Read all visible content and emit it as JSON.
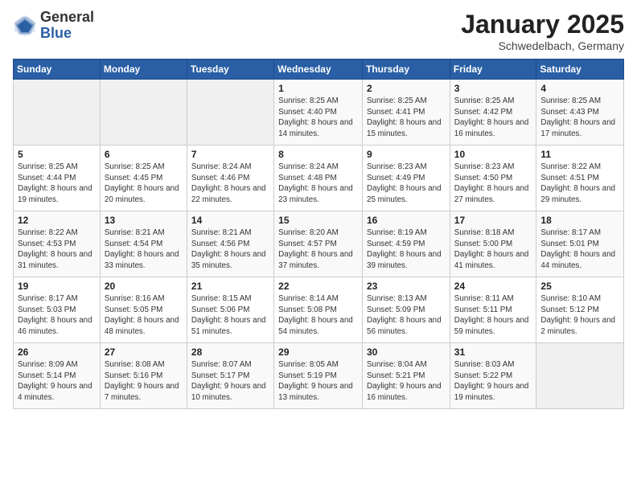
{
  "logo": {
    "general": "General",
    "blue": "Blue"
  },
  "header": {
    "month": "January 2025",
    "location": "Schwedelbach, Germany"
  },
  "weekdays": [
    "Sunday",
    "Monday",
    "Tuesday",
    "Wednesday",
    "Thursday",
    "Friday",
    "Saturday"
  ],
  "weeks": [
    [
      {
        "day": "",
        "sunrise": "",
        "sunset": "",
        "daylight": ""
      },
      {
        "day": "",
        "sunrise": "",
        "sunset": "",
        "daylight": ""
      },
      {
        "day": "",
        "sunrise": "",
        "sunset": "",
        "daylight": ""
      },
      {
        "day": "1",
        "sunrise": "Sunrise: 8:25 AM",
        "sunset": "Sunset: 4:40 PM",
        "daylight": "Daylight: 8 hours and 14 minutes."
      },
      {
        "day": "2",
        "sunrise": "Sunrise: 8:25 AM",
        "sunset": "Sunset: 4:41 PM",
        "daylight": "Daylight: 8 hours and 15 minutes."
      },
      {
        "day": "3",
        "sunrise": "Sunrise: 8:25 AM",
        "sunset": "Sunset: 4:42 PM",
        "daylight": "Daylight: 8 hours and 16 minutes."
      },
      {
        "day": "4",
        "sunrise": "Sunrise: 8:25 AM",
        "sunset": "Sunset: 4:43 PM",
        "daylight": "Daylight: 8 hours and 17 minutes."
      }
    ],
    [
      {
        "day": "5",
        "sunrise": "Sunrise: 8:25 AM",
        "sunset": "Sunset: 4:44 PM",
        "daylight": "Daylight: 8 hours and 19 minutes."
      },
      {
        "day": "6",
        "sunrise": "Sunrise: 8:25 AM",
        "sunset": "Sunset: 4:45 PM",
        "daylight": "Daylight: 8 hours and 20 minutes."
      },
      {
        "day": "7",
        "sunrise": "Sunrise: 8:24 AM",
        "sunset": "Sunset: 4:46 PM",
        "daylight": "Daylight: 8 hours and 22 minutes."
      },
      {
        "day": "8",
        "sunrise": "Sunrise: 8:24 AM",
        "sunset": "Sunset: 4:48 PM",
        "daylight": "Daylight: 8 hours and 23 minutes."
      },
      {
        "day": "9",
        "sunrise": "Sunrise: 8:23 AM",
        "sunset": "Sunset: 4:49 PM",
        "daylight": "Daylight: 8 hours and 25 minutes."
      },
      {
        "day": "10",
        "sunrise": "Sunrise: 8:23 AM",
        "sunset": "Sunset: 4:50 PM",
        "daylight": "Daylight: 8 hours and 27 minutes."
      },
      {
        "day": "11",
        "sunrise": "Sunrise: 8:22 AM",
        "sunset": "Sunset: 4:51 PM",
        "daylight": "Daylight: 8 hours and 29 minutes."
      }
    ],
    [
      {
        "day": "12",
        "sunrise": "Sunrise: 8:22 AM",
        "sunset": "Sunset: 4:53 PM",
        "daylight": "Daylight: 8 hours and 31 minutes."
      },
      {
        "day": "13",
        "sunrise": "Sunrise: 8:21 AM",
        "sunset": "Sunset: 4:54 PM",
        "daylight": "Daylight: 8 hours and 33 minutes."
      },
      {
        "day": "14",
        "sunrise": "Sunrise: 8:21 AM",
        "sunset": "Sunset: 4:56 PM",
        "daylight": "Daylight: 8 hours and 35 minutes."
      },
      {
        "day": "15",
        "sunrise": "Sunrise: 8:20 AM",
        "sunset": "Sunset: 4:57 PM",
        "daylight": "Daylight: 8 hours and 37 minutes."
      },
      {
        "day": "16",
        "sunrise": "Sunrise: 8:19 AM",
        "sunset": "Sunset: 4:59 PM",
        "daylight": "Daylight: 8 hours and 39 minutes."
      },
      {
        "day": "17",
        "sunrise": "Sunrise: 8:18 AM",
        "sunset": "Sunset: 5:00 PM",
        "daylight": "Daylight: 8 hours and 41 minutes."
      },
      {
        "day": "18",
        "sunrise": "Sunrise: 8:17 AM",
        "sunset": "Sunset: 5:01 PM",
        "daylight": "Daylight: 8 hours and 44 minutes."
      }
    ],
    [
      {
        "day": "19",
        "sunrise": "Sunrise: 8:17 AM",
        "sunset": "Sunset: 5:03 PM",
        "daylight": "Daylight: 8 hours and 46 minutes."
      },
      {
        "day": "20",
        "sunrise": "Sunrise: 8:16 AM",
        "sunset": "Sunset: 5:05 PM",
        "daylight": "Daylight: 8 hours and 48 minutes."
      },
      {
        "day": "21",
        "sunrise": "Sunrise: 8:15 AM",
        "sunset": "Sunset: 5:06 PM",
        "daylight": "Daylight: 8 hours and 51 minutes."
      },
      {
        "day": "22",
        "sunrise": "Sunrise: 8:14 AM",
        "sunset": "Sunset: 5:08 PM",
        "daylight": "Daylight: 8 hours and 54 minutes."
      },
      {
        "day": "23",
        "sunrise": "Sunrise: 8:13 AM",
        "sunset": "Sunset: 5:09 PM",
        "daylight": "Daylight: 8 hours and 56 minutes."
      },
      {
        "day": "24",
        "sunrise": "Sunrise: 8:11 AM",
        "sunset": "Sunset: 5:11 PM",
        "daylight": "Daylight: 8 hours and 59 minutes."
      },
      {
        "day": "25",
        "sunrise": "Sunrise: 8:10 AM",
        "sunset": "Sunset: 5:12 PM",
        "daylight": "Daylight: 9 hours and 2 minutes."
      }
    ],
    [
      {
        "day": "26",
        "sunrise": "Sunrise: 8:09 AM",
        "sunset": "Sunset: 5:14 PM",
        "daylight": "Daylight: 9 hours and 4 minutes."
      },
      {
        "day": "27",
        "sunrise": "Sunrise: 8:08 AM",
        "sunset": "Sunset: 5:16 PM",
        "daylight": "Daylight: 9 hours and 7 minutes."
      },
      {
        "day": "28",
        "sunrise": "Sunrise: 8:07 AM",
        "sunset": "Sunset: 5:17 PM",
        "daylight": "Daylight: 9 hours and 10 minutes."
      },
      {
        "day": "29",
        "sunrise": "Sunrise: 8:05 AM",
        "sunset": "Sunset: 5:19 PM",
        "daylight": "Daylight: 9 hours and 13 minutes."
      },
      {
        "day": "30",
        "sunrise": "Sunrise: 8:04 AM",
        "sunset": "Sunset: 5:21 PM",
        "daylight": "Daylight: 9 hours and 16 minutes."
      },
      {
        "day": "31",
        "sunrise": "Sunrise: 8:03 AM",
        "sunset": "Sunset: 5:22 PM",
        "daylight": "Daylight: 9 hours and 19 minutes."
      },
      {
        "day": "",
        "sunrise": "",
        "sunset": "",
        "daylight": ""
      }
    ]
  ]
}
